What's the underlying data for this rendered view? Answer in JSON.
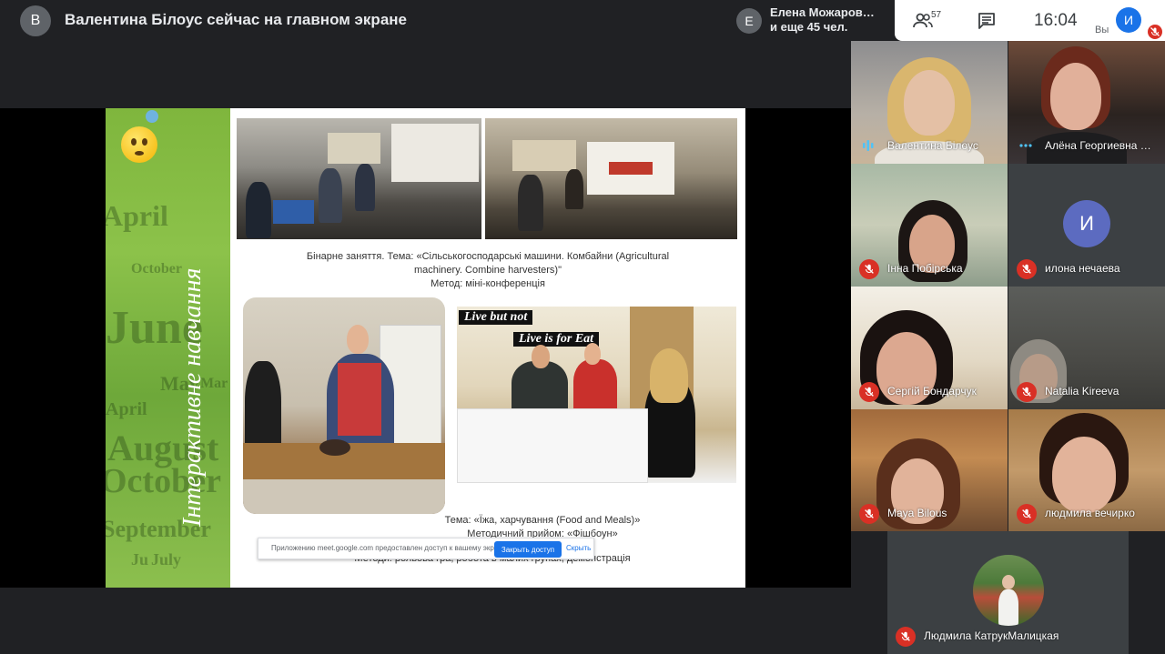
{
  "presenter": {
    "avatar_letter": "В",
    "title": "Валентина Білоус сейчас на главном экране"
  },
  "notice": {
    "avatar_letter": "Е",
    "line1": "Елена Можаров…",
    "line2": "и еще 45 чел."
  },
  "controls": {
    "people_count": "57",
    "time": "16:04",
    "self_letter": "И",
    "self_label": "Вы"
  },
  "slide": {
    "side_title": "Інтерактивне навчання",
    "decor_words": [
      "April",
      "October",
      "June",
      "May",
      "April",
      "August",
      "October",
      "September",
      "July",
      "Ju",
      "Mar"
    ],
    "caption1_line1": "Бінарне заняття. Тема: «Сільськогосподарські машини. Комбайни (Agricultural",
    "caption1_line2": "machinery. Combine harvesters)\"",
    "caption1_line3": "Метод: міні-конференція",
    "banner_top": "Live  but not",
    "banner_bottom": "Live is for Eat",
    "caption2_line1": "Тема: «Їжа, харчування (Food and Meals)»",
    "caption2_line2": "Методичний прийом: «Фішбоун»",
    "caption3": "Методи: рольова гра, робота в малих групах, демонстрація"
  },
  "share_bar": {
    "text": "Приложению meet.google.com предоставлен доступ к вашему экрану.",
    "stop_label": "Закрыть доступ",
    "hide_label": "Скрыть"
  },
  "tiles": [
    {
      "name": "Валентина Білоус",
      "muted": false,
      "status": "speaking"
    },
    {
      "name": "Алёна Георгиевна …",
      "muted": false,
      "status": "active"
    },
    {
      "name": "Інна Побірська",
      "muted": true
    },
    {
      "name": "илона нечаева",
      "muted": true,
      "avatar_letter": "И"
    },
    {
      "name": "Сергій Бондарчук",
      "muted": true
    },
    {
      "name": "Natalia Kireeva",
      "muted": true
    },
    {
      "name": "Maya Bilous",
      "muted": true
    },
    {
      "name": "людмила вечирко",
      "muted": true
    },
    {
      "name": "Людмила КатрукМалицкая",
      "muted": true
    }
  ],
  "colors": {
    "background": "#202124",
    "mic_off": "#d93025",
    "accent": "#1a73e8",
    "speaking": "#4fc3f7",
    "avatar_purple": "#5c6bc0"
  }
}
